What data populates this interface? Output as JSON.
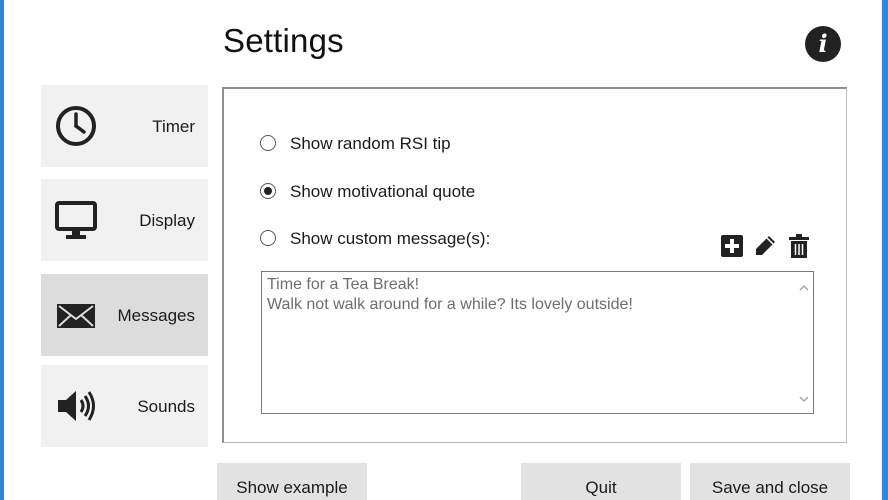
{
  "window": {
    "title": "Settings",
    "frame_color": "#2f86d8"
  },
  "header": {
    "info_icon_glyph": "i",
    "info_icon": "info-icon"
  },
  "sidebar": {
    "items": [
      {
        "label": "Timer",
        "icon": "clock-icon",
        "active": false
      },
      {
        "label": "Display",
        "icon": "monitor-icon",
        "active": false
      },
      {
        "label": "Messages",
        "icon": "envelope-icon",
        "active": true
      },
      {
        "label": "Sounds",
        "icon": "speaker-icon",
        "active": false
      }
    ]
  },
  "messages_panel": {
    "options": [
      {
        "label": "Show random RSI tip",
        "selected": false
      },
      {
        "label": "Show motivational quote",
        "selected": true
      },
      {
        "label": "Show custom message(s):",
        "selected": false
      }
    ],
    "toolbar": {
      "add": "add-icon",
      "edit": "pencil-icon",
      "delete": "trash-icon"
    },
    "custom_messages": [
      "Time for a Tea Break!",
      "Walk not walk around for a while? Its lovely outside!"
    ]
  },
  "footer": {
    "show_example_label": "Show example",
    "quit_label": "Quit",
    "save_label": "Save and close"
  }
}
